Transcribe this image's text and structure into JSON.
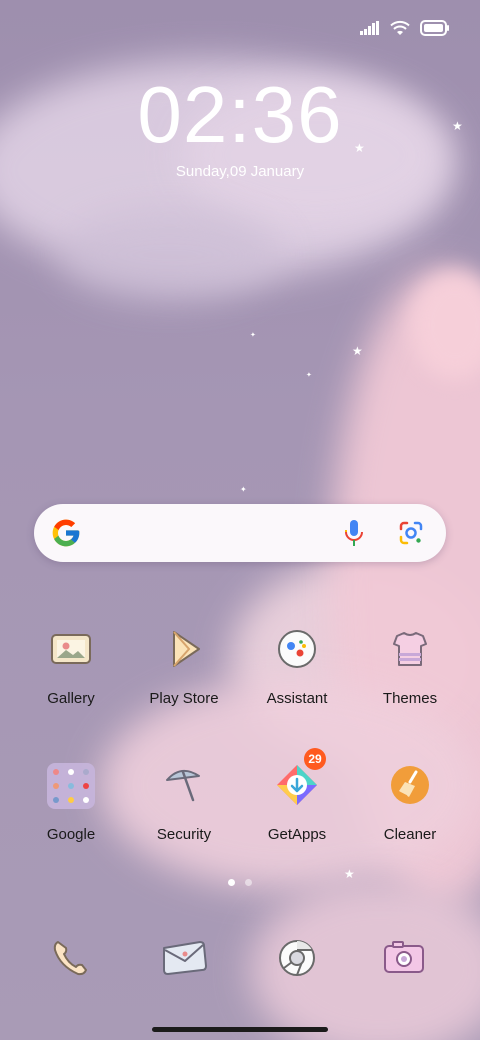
{
  "clock": {
    "time": "02:36",
    "date": "Sunday,09 January"
  },
  "status_bar": {
    "signal_icon": "signal-icon",
    "wifi_icon": "wifi-icon",
    "battery_icon": "battery-icon"
  },
  "search": {
    "logo_icon": "google-g-icon",
    "mic_icon": "mic-icon",
    "lens_icon": "lens-icon"
  },
  "apps_row1": [
    {
      "label": "Gallery",
      "icon": "gallery-icon"
    },
    {
      "label": "Play Store",
      "icon": "play-store-icon"
    },
    {
      "label": "Assistant",
      "icon": "assistant-icon"
    },
    {
      "label": "Themes",
      "icon": "themes-icon"
    }
  ],
  "apps_row2": [
    {
      "label": "Google",
      "icon": "google-folder-icon"
    },
    {
      "label": "Security",
      "icon": "security-icon"
    },
    {
      "label": "GetApps",
      "icon": "getapps-icon",
      "badge": "29"
    },
    {
      "label": "Cleaner",
      "icon": "cleaner-icon"
    }
  ],
  "dock": [
    {
      "icon": "phone-icon"
    },
    {
      "icon": "messages-icon"
    },
    {
      "icon": "chrome-icon"
    },
    {
      "icon": "camera-icon"
    }
  ],
  "page_indicator": {
    "pages": 2,
    "current": 1
  },
  "colors": {
    "wallpaper": "#a799b3",
    "badge": "#ff5a1f",
    "text": "#1a1a1a"
  }
}
